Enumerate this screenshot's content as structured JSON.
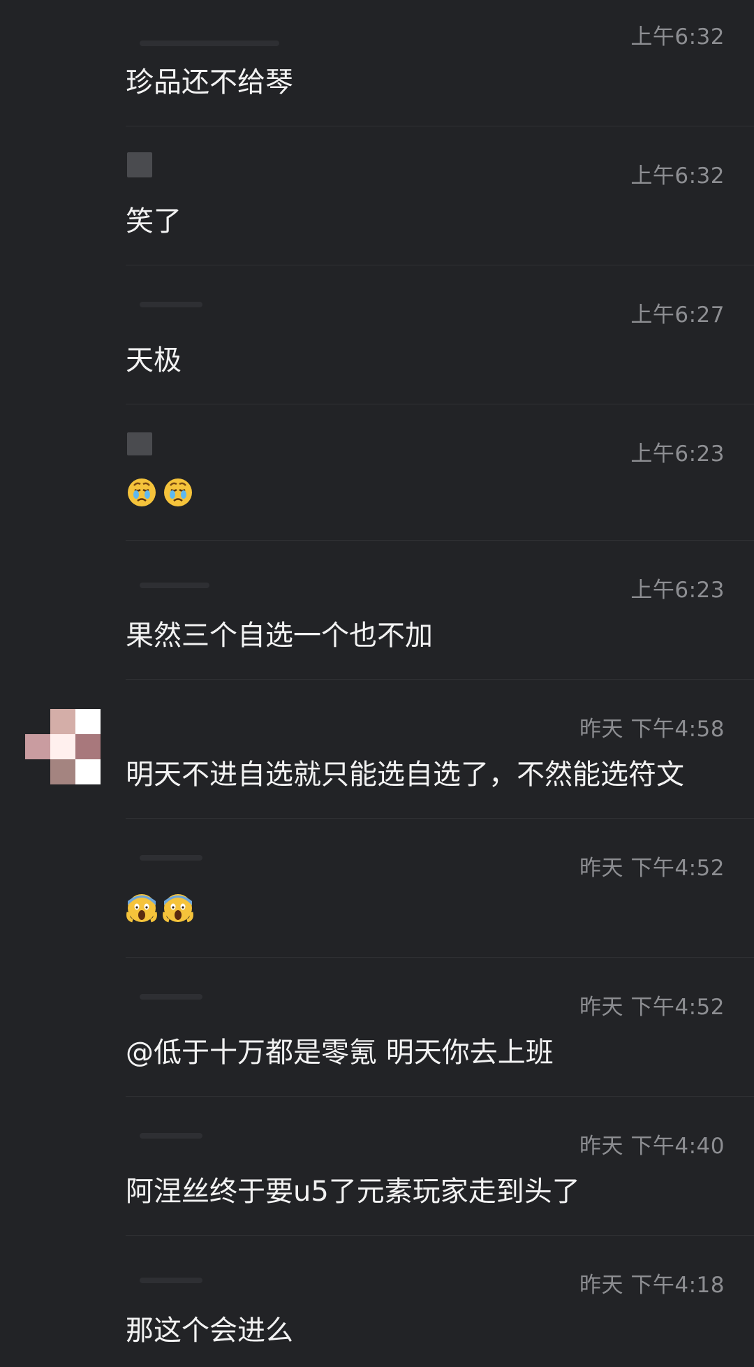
{
  "messages": [
    {
      "time": "上午6:32",
      "text": "珍品还不给琴"
    },
    {
      "time": "上午6:32",
      "text": "笑了"
    },
    {
      "time": "上午6:27",
      "text": "天极"
    },
    {
      "time": "上午6:23",
      "emojis": [
        "weary-crying-face-icon",
        "weary-crying-face-icon"
      ]
    },
    {
      "time": "上午6:23",
      "text": "果然三个自选一个也不加"
    },
    {
      "time": "昨天 下午4:58",
      "text": "明天不进自选就只能选自选了，不然能选符文"
    },
    {
      "time": "昨天 下午4:52",
      "emojis": [
        "screaming-face-icon",
        "screaming-face-icon"
      ]
    },
    {
      "time": "昨天 下午4:52",
      "text": "@低于十万都是零氪 明天你去上班"
    },
    {
      "time": "昨天 下午4:40",
      "text": "阿涅丝终于要u5了元素玩家走到头了"
    },
    {
      "time": "昨天 下午4:18",
      "text": "那这个会进么"
    }
  ],
  "colors": {
    "background": "#222326",
    "text": "#f2f2f2",
    "timestamp": "#8d8e92",
    "divider": "#303134"
  }
}
